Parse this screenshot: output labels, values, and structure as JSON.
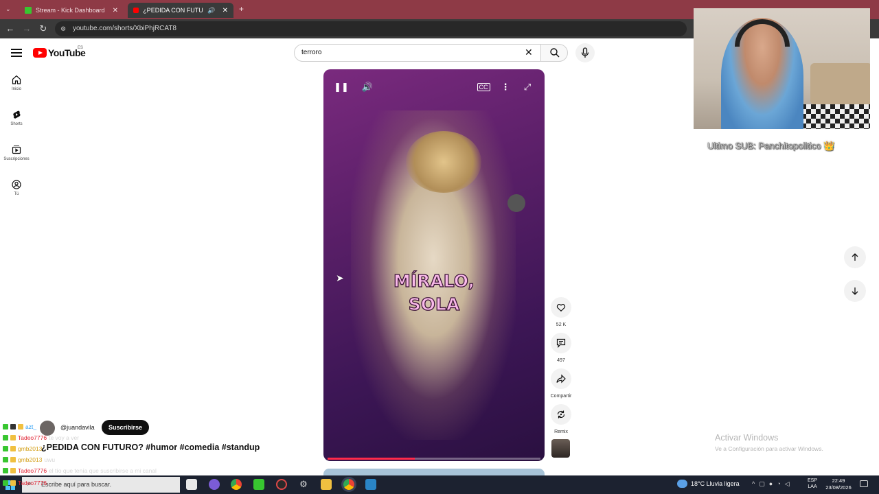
{
  "browser": {
    "tabs": [
      {
        "title": "Stream - Kick Dashboard",
        "close": "✕"
      },
      {
        "title": "¿PEDIDA CON FUTURO? #h",
        "close": "✕"
      }
    ],
    "new_tab": "+",
    "url": "youtube.com/shorts/XbiPhjRCAT8"
  },
  "youtube": {
    "logo_text": "YouTube",
    "region": "ES",
    "search_value": "terroro",
    "sidebar": [
      {
        "label": "Inicio",
        "icon": "home-icon"
      },
      {
        "label": "Shorts",
        "icon": "shorts-icon"
      },
      {
        "label": "Suscripciones",
        "icon": "subscriptions-icon"
      },
      {
        "label": "Tú",
        "icon": "you-icon"
      }
    ],
    "video": {
      "caption_line1": "MÍRALO,",
      "caption_line2": "SOLA",
      "progress": 0.41
    },
    "actions": [
      {
        "label": "52 K",
        "icon": "like-icon"
      },
      {
        "label": "497",
        "icon": "comment-icon"
      },
      {
        "label": "Compartir",
        "icon": "share-icon"
      },
      {
        "label": "Remix",
        "icon": "remix-icon"
      }
    ],
    "channel_handle": "@juandavila",
    "subscribe_label": "Suscribirse",
    "video_title": "¿PEDIDA CON FUTURO? #humor #comedia #standup"
  },
  "stream": {
    "last_sub": "Ultimo SUB: Panchitopolitico 👑",
    "chat": [
      {
        "user": "azt_",
        "color": "#2a9df4",
        "message": ""
      },
      {
        "user": "Tadeo7776",
        "color": "#e01f2f",
        "message": "te voy a ver"
      },
      {
        "user": "gmb2013",
        "color": "#d4a019",
        "message": ""
      },
      {
        "user": "gmb2013",
        "color": "#d4a019",
        "message": "uwu"
      },
      {
        "user": "Tadeo7776",
        "color": "#e01f2f",
        "message": "el tío que tenía que suscribirse a mi canal"
      },
      {
        "user": "Tadeo7776",
        "color": "#e01f2f",
        "message": ""
      }
    ]
  },
  "windows": {
    "activate_title": "Activar Windows",
    "activate_sub": "Ve a Configuración para activar Windows.",
    "search_placeholder": "Escribe aquí para buscar.",
    "weather": "18°C  Lluvia ligera",
    "lang_1": "ESP",
    "lang_2": "LAA",
    "time": "22:49",
    "date": "23/08/2026"
  }
}
